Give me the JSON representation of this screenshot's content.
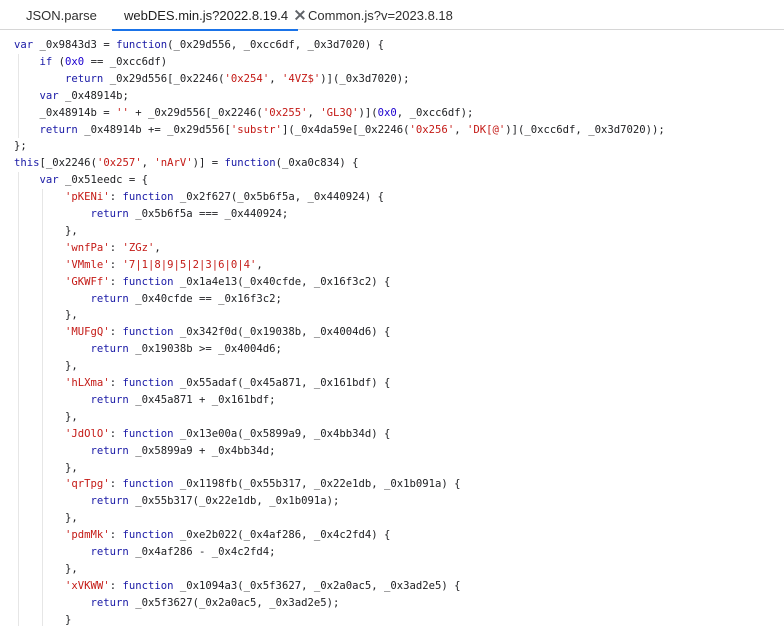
{
  "tabs": [
    {
      "label": "JSON.parse",
      "active": false,
      "closable": false
    },
    {
      "label": "webDES.min.js?2022.8.19.4",
      "active": true,
      "closable": true
    },
    {
      "label": "Common.js?v=2023.8.18",
      "active": false,
      "closable": false
    }
  ],
  "code_lines": [
    "var _0x9843d3 = function(_0x29d556, _0xcc6df, _0x3d7020) {",
    "    if (0x0 == _0xcc6df)",
    "        return _0x29d556[_0x2246('0x254', '4VZ$')](_0x3d7020);",
    "    var _0x48914b;",
    "    _0x48914b = '' + _0x29d556[_0x2246('0x255', 'GL3Q')](0x0, _0xcc6df);",
    "    return _0x48914b += _0x29d556['substr'](_0x4da59e[_0x2246('0x256', 'DK[@')](_0xcc6df, _0x3d7020));",
    "};",
    "this[_0x2246('0x257', 'nArV')] = function(_0xa0c834) {",
    "    var _0x51eedc = {",
    "        'pKENi': function _0x2f627(_0x5b6f5a, _0x440924) {",
    "            return _0x5b6f5a === _0x440924;",
    "        },",
    "        'wnfPa': 'ZGz',",
    "        'VMmle': '7|1|8|9|5|2|3|6|0|4',",
    "        'GKWFf': function _0x1a4e13(_0x40cfde, _0x16f3c2) {",
    "            return _0x40cfde == _0x16f3c2;",
    "        },",
    "        'MUFgQ': function _0x342f0d(_0x19038b, _0x4004d6) {",
    "            return _0x19038b >= _0x4004d6;",
    "        },",
    "        'hLXma': function _0x55adaf(_0x45a871, _0x161bdf) {",
    "            return _0x45a871 + _0x161bdf;",
    "        },",
    "        'JdOlO': function _0x13e00a(_0x5899a9, _0x4bb34d) {",
    "            return _0x5899a9 + _0x4bb34d;",
    "        },",
    "        'qrTpg': function _0x1198fb(_0x55b317, _0x22e1db, _0x1b091a) {",
    "            return _0x55b317(_0x22e1db, _0x1b091a);",
    "        },",
    "        'pdmMk': function _0xe2b022(_0x4af286, _0x4c2fd4) {",
    "            return _0x4af286 - _0x4c2fd4;",
    "        },",
    "        'xVKWW': function _0x1094a3(_0x5f3627, _0x2a0ac5, _0x3ad2e5) {",
    "            return _0x5f3627(_0x2a0ac5, _0x3ad2e5);",
    "        }"
  ],
  "colors": {
    "keyword": "#1a1aa6",
    "string": "#c41a16",
    "number": "#1c00cf",
    "active_tab_underline": "#1a73e8"
  }
}
